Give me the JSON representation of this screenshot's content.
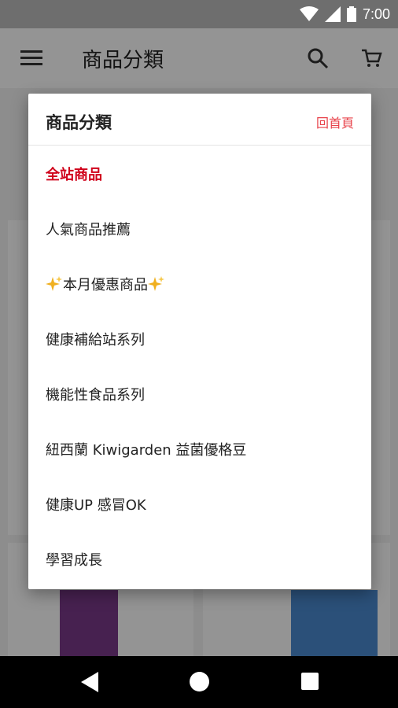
{
  "status_bar": {
    "time": "7:00"
  },
  "app_bar": {
    "title": "商品分類",
    "icons": [
      "menu-icon",
      "search-icon",
      "cart-icon"
    ]
  },
  "dialog": {
    "title": "商品分類",
    "home_link": "回首頁",
    "categories": [
      {
        "label": "全站商品",
        "active": true
      },
      {
        "label": "人氣商品推薦",
        "active": false
      },
      {
        "label": "本月優惠商品",
        "active": false,
        "decoration": "sparkle-icon"
      },
      {
        "label": "健康補給站系列",
        "active": false
      },
      {
        "label": "機能性食品系列",
        "active": false
      },
      {
        "label": "紐西蘭 Kiwigarden 益菌優格豆",
        "active": false
      },
      {
        "label": "健康UP 感冒OK",
        "active": false
      },
      {
        "label": "學習成長",
        "active": false
      }
    ]
  },
  "colors": {
    "accent_red": "#d0021b",
    "link_red": "#e8424a",
    "sparkle_gold": "#f0b020"
  },
  "nav_bar": {
    "icons": [
      "back-icon",
      "home-icon",
      "recents-icon"
    ]
  }
}
